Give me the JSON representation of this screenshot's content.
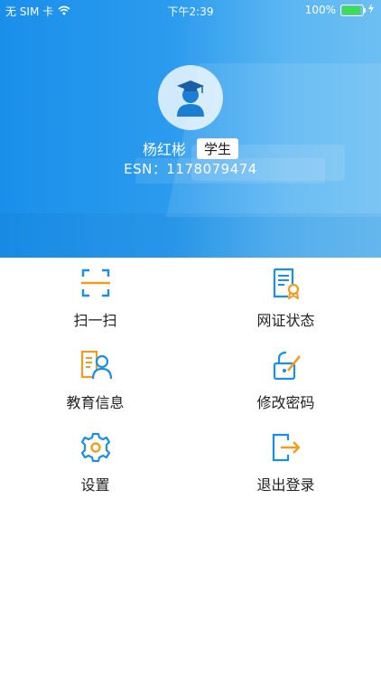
{
  "status": {
    "carrier": "无 SIM 卡",
    "time": "下午2:39",
    "battery": "100%"
  },
  "profile": {
    "name": "杨红彬",
    "role": "学生",
    "esn": "ESN：1178079474"
  },
  "menu": [
    {
      "label": "扫一扫",
      "icon": "scan-icon"
    },
    {
      "label": "网证状态",
      "icon": "certificate-icon"
    },
    {
      "label": "教育信息",
      "icon": "education-info-icon"
    },
    {
      "label": "修改密码",
      "icon": "edit-password-icon"
    },
    {
      "label": "设置",
      "icon": "settings-gear-icon"
    },
    {
      "label": "退出登录",
      "icon": "logout-icon"
    }
  ],
  "colors": {
    "primary": "#1a8fea",
    "accent": "#f39c22"
  }
}
